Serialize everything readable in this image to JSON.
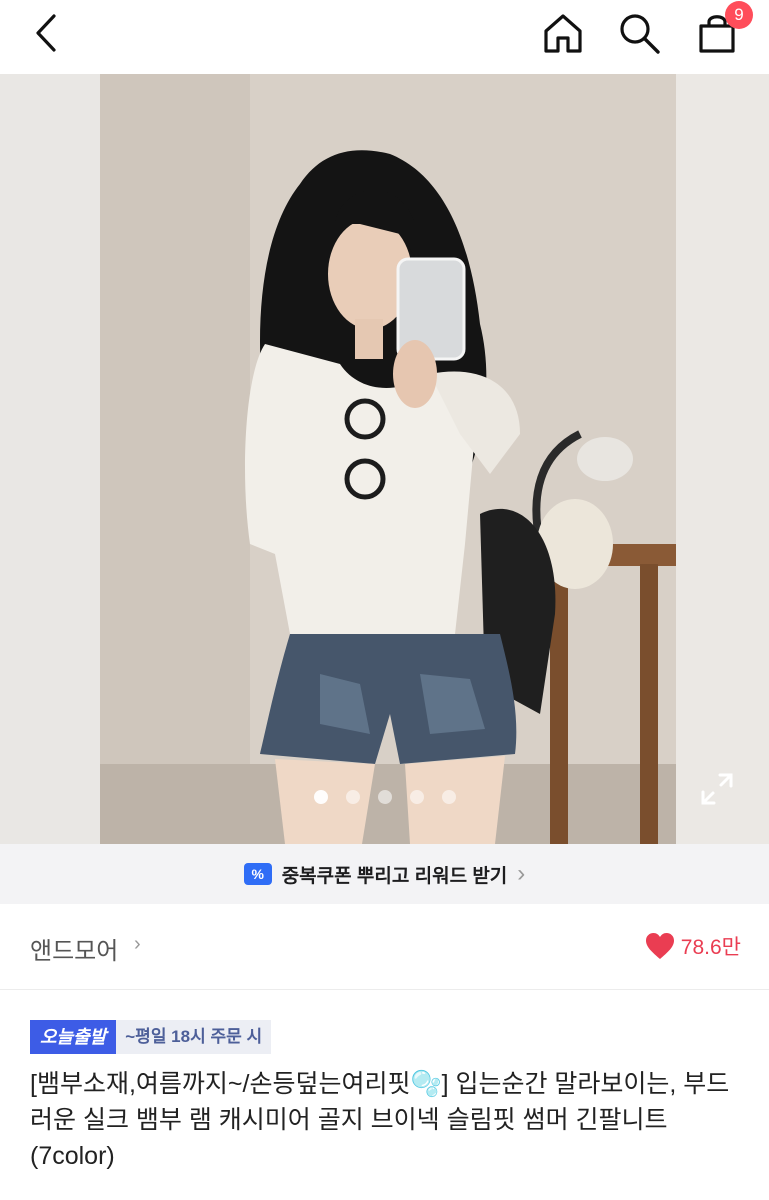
{
  "topbar": {
    "back_icon": "chevron-left-icon",
    "home_icon": "home-icon",
    "search_icon": "search-icon",
    "cart_icon": "shopping-bag-icon",
    "cart_count": "9"
  },
  "gallery": {
    "slide_count": 5,
    "active_index": 0,
    "expand_icon": "expand-icon"
  },
  "coupon": {
    "icon": "coupon-icon",
    "text": "중복쿠폰 뿌리고 리워드 받기",
    "chevron": "›"
  },
  "brand": {
    "name": "앤드모어",
    "chevron": "›",
    "like_icon": "heart-icon",
    "like_count": "78.6만"
  },
  "badges": {
    "today": "오늘출발",
    "cutoff": "~평일 18시 주문 시"
  },
  "product": {
    "title": "[뱀부소재,여름까지~/손등덮는여리핏🫧] 입는순간 말라보이는, 부드러운 실크 뱀부 램 캐시미어 골지 브이넥 슬림핏 썸머 긴팔니트 (7color)"
  },
  "colors": {
    "badge_red": "#ff4d5a",
    "heart": "#ea3d52",
    "today_blue": "#3d5ce6",
    "coupon_blue": "#2f6df6"
  }
}
